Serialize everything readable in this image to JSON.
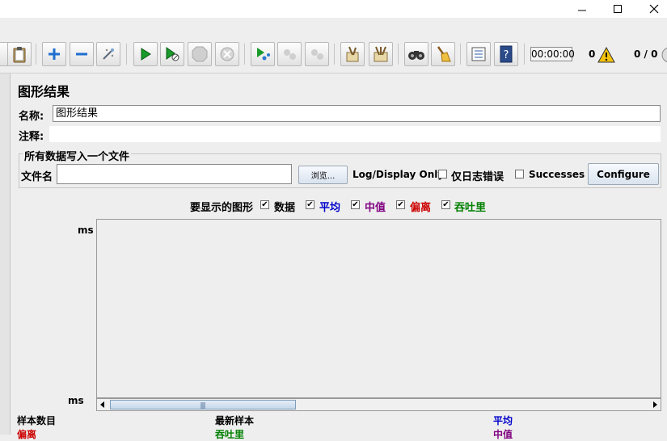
{
  "window": {
    "controls": [
      "minimize",
      "maximize",
      "close"
    ]
  },
  "toolbar": {
    "timer": "00:00:00",
    "warning_count": "0",
    "thread_count": "0 / 0"
  },
  "panel": {
    "title": "图形结果",
    "name_label": "名称:",
    "name_value": "图形结果",
    "comment_label": "注释:",
    "comment_value": ""
  },
  "file_section": {
    "title": "所有数据写入一个文件",
    "filename_label": "文件名",
    "filename_value": "",
    "browse_label": "浏览...",
    "log_display_label": "Log/Display Only:",
    "errors_only_label": "仅日志错误",
    "successes_label": "Successes",
    "configure_label": "Configure"
  },
  "graphs": {
    "label": "要显示的图形",
    "options": [
      {
        "label": "数据",
        "checked": true,
        "color": "#000000"
      },
      {
        "label": "平均",
        "checked": true,
        "color": "#0000cc"
      },
      {
        "label": "中值",
        "checked": true,
        "color": "#800080"
      },
      {
        "label": "偏离",
        "checked": true,
        "color": "#cc0000"
      },
      {
        "label": "吞吐里",
        "checked": true,
        "color": "#008000"
      }
    ]
  },
  "chart": {
    "y_top_label": "ms",
    "y_bottom_label": "ms"
  },
  "stats": {
    "samples_label": "样本数目",
    "latest_label": "最新样本",
    "average_label": "平均",
    "deviation_label": "偏离",
    "throughput_label": "吞吐里",
    "median_label": "中值"
  },
  "colors": {
    "accent_blue": "#0000cc",
    "purple": "#800080",
    "red": "#cc0000",
    "green": "#008000"
  }
}
